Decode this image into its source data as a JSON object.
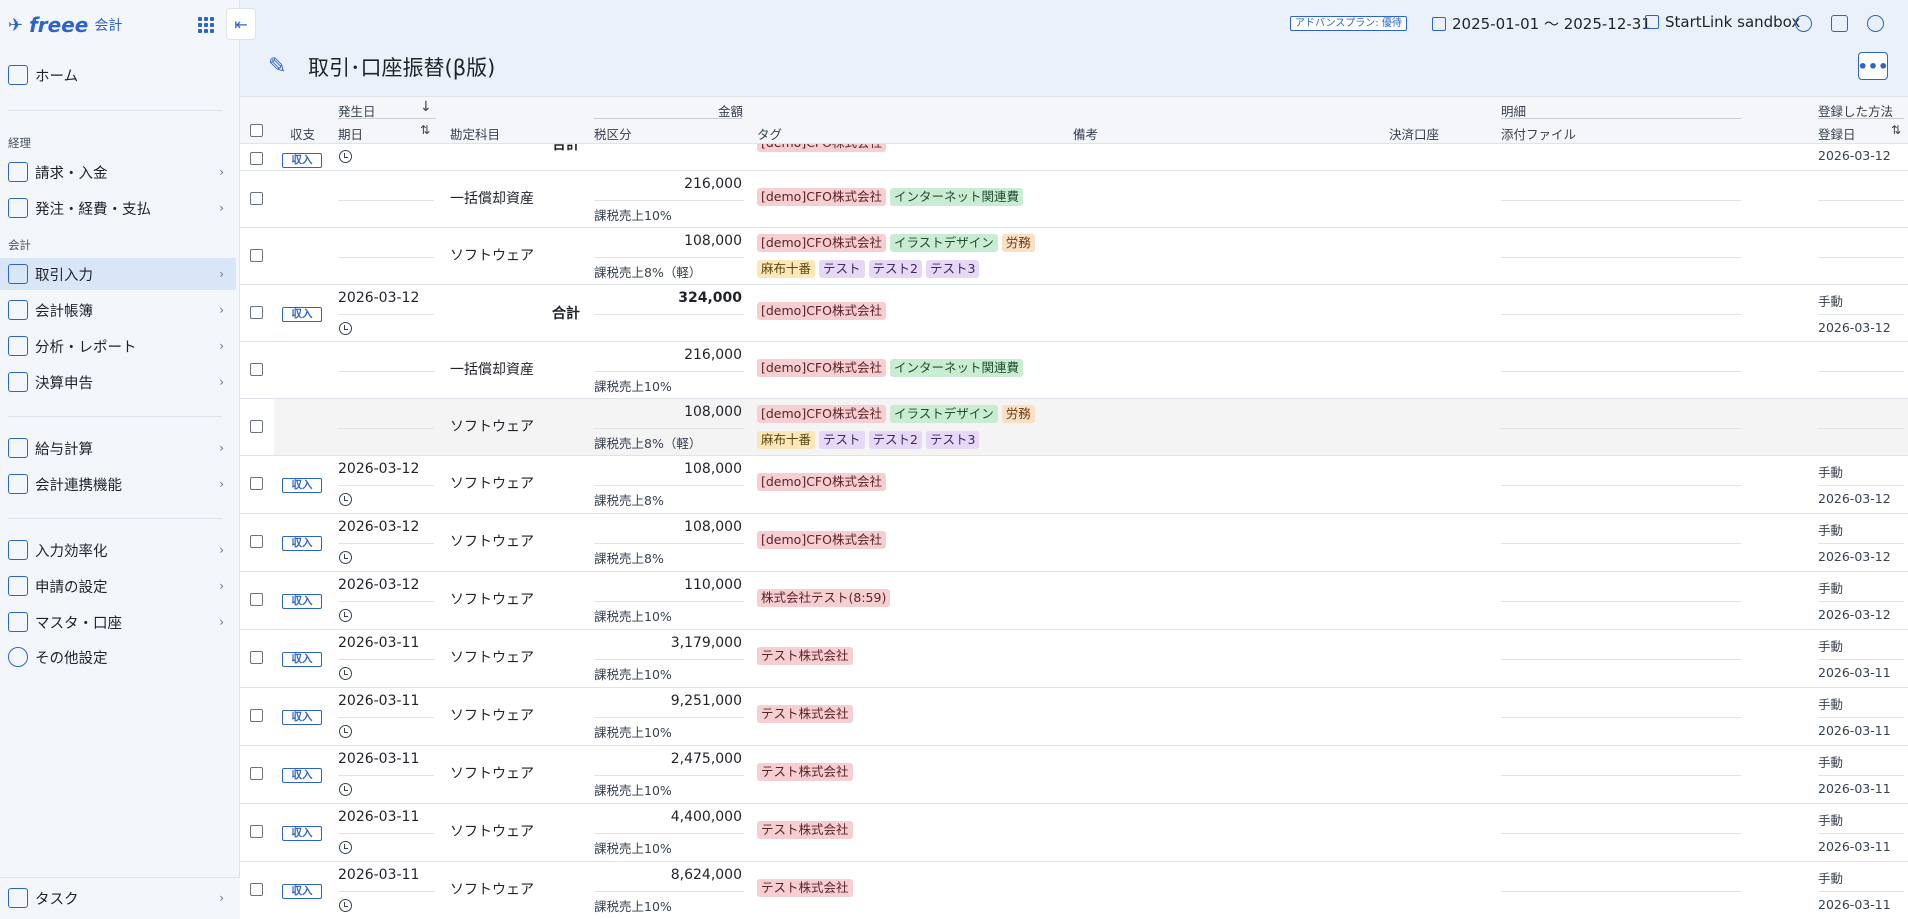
{
  "brand": {
    "logo": "freee",
    "product": "会計"
  },
  "sidebar": {
    "home": "ホーム",
    "group_keiri": "経理",
    "seikyu": "請求・入金",
    "hatchu": "発注・経費・支払",
    "group_kaikei": "会計",
    "torihiki": "取引入力",
    "choubo": "会計帳簿",
    "bunseki": "分析・レポート",
    "kessan": "決算申告",
    "kyuyo": "給与計算",
    "renkei": "会計連携機能",
    "kouritsu": "入力効率化",
    "shinsei": "申請の設定",
    "master": "マスタ・口座",
    "sonota": "その他設定",
    "task": "タスク"
  },
  "topbar": {
    "plan": "アドバンスプラン: 優待",
    "period": "2025-01-01 〜 2025-12-31",
    "company": "StartLink sandbox"
  },
  "page": {
    "title": "取引･口座振替(β版)",
    "more": "•••"
  },
  "table": {
    "headers": {
      "hasseibi": "発生日",
      "kijitsu": "期日",
      "shushi": "収支",
      "kanjou": "勘定科目",
      "kingaku": "金額",
      "zeiku": "税区分",
      "tag": "タグ",
      "bikou": "備考",
      "kessai": "決済口座",
      "meisai": "明細",
      "tenpu": "添付ファイル",
      "houhou": "登録した方法",
      "tourokubi": "登録日"
    },
    "rows": [
      {
        "date": "",
        "income": "収入",
        "account": "合計",
        "amount": "",
        "tax": "",
        "tags": [
          [
            "[demo]CFO株式会社",
            "red"
          ]
        ],
        "method": "",
        "regdate": "2026-03-12"
      },
      {
        "date": "",
        "income": "",
        "account": "一括償却資産",
        "amount": "216,000",
        "tax": "課税売上10%",
        "tags": [
          [
            "[demo]CFO株式会社",
            "red"
          ],
          [
            "インターネット関連費",
            "green"
          ]
        ],
        "method": "",
        "regdate": ""
      },
      {
        "date": "",
        "income": "",
        "account": "ソフトウェア",
        "amount": "108,000",
        "tax": "課税売上8%（軽）",
        "tags": [
          [
            "[demo]CFO株式会社",
            "red"
          ],
          [
            "イラストデザイン",
            "green"
          ],
          [
            "労務",
            "orange"
          ],
          [
            "麻布十番",
            "yellow"
          ],
          [
            "テスト",
            "purple"
          ],
          [
            "テスト2",
            "purple"
          ],
          [
            "テスト3",
            "purple"
          ]
        ],
        "method": "",
        "regdate": ""
      },
      {
        "date": "2026-03-12",
        "income": "収入",
        "account": "合計",
        "amount": "324,000",
        "tax": "",
        "tags": [
          [
            "[demo]CFO株式会社",
            "red"
          ]
        ],
        "method": "手動",
        "regdate": "2026-03-12"
      },
      {
        "date": "",
        "income": "",
        "account": "一括償却資産",
        "amount": "216,000",
        "tax": "課税売上10%",
        "tags": [
          [
            "[demo]CFO株式会社",
            "red"
          ],
          [
            "インターネット関連費",
            "green"
          ]
        ],
        "method": "",
        "regdate": ""
      },
      {
        "date": "",
        "income": "",
        "account": "ソフトウェア",
        "amount": "108,000",
        "tax": "課税売上8%（軽）",
        "tags": [
          [
            "[demo]CFO株式会社",
            "red"
          ],
          [
            "イラストデザイン",
            "green"
          ],
          [
            "労務",
            "orange"
          ],
          [
            "麻布十番",
            "yellow"
          ],
          [
            "テスト",
            "purple"
          ],
          [
            "テスト2",
            "purple"
          ],
          [
            "テスト3",
            "purple"
          ]
        ],
        "method": "",
        "regdate": ""
      },
      {
        "date": "2026-03-12",
        "income": "収入",
        "account": "ソフトウェア",
        "amount": "108,000",
        "tax": "課税売上8%",
        "tags": [
          [
            "[demo]CFO株式会社",
            "red"
          ]
        ],
        "method": "手動",
        "regdate": "2026-03-12"
      },
      {
        "date": "2026-03-12",
        "income": "収入",
        "account": "ソフトウェア",
        "amount": "108,000",
        "tax": "課税売上8%",
        "tags": [
          [
            "[demo]CFO株式会社",
            "red"
          ]
        ],
        "method": "手動",
        "regdate": "2026-03-12"
      },
      {
        "date": "2026-03-12",
        "income": "収入",
        "account": "ソフトウェア",
        "amount": "110,000",
        "tax": "課税売上10%",
        "tags": [
          [
            "株式会社テスト(8:59)",
            "red"
          ]
        ],
        "method": "手動",
        "regdate": "2026-03-12"
      },
      {
        "date": "2026-03-11",
        "income": "収入",
        "account": "ソフトウェア",
        "amount": "3,179,000",
        "tax": "課税売上10%",
        "tags": [
          [
            "テスト株式会社",
            "red"
          ]
        ],
        "method": "手動",
        "regdate": "2026-03-11"
      },
      {
        "date": "2026-03-11",
        "income": "収入",
        "account": "ソフトウェア",
        "amount": "9,251,000",
        "tax": "課税売上10%",
        "tags": [
          [
            "テスト株式会社",
            "red"
          ]
        ],
        "method": "手動",
        "regdate": "2026-03-11"
      },
      {
        "date": "2026-03-11",
        "income": "収入",
        "account": "ソフトウェア",
        "amount": "2,475,000",
        "tax": "課税売上10%",
        "tags": [
          [
            "テスト株式会社",
            "red"
          ]
        ],
        "method": "手動",
        "regdate": "2026-03-11"
      },
      {
        "date": "2026-03-11",
        "income": "収入",
        "account": "ソフトウェア",
        "amount": "4,400,000",
        "tax": "課税売上10%",
        "tags": [
          [
            "テスト株式会社",
            "red"
          ]
        ],
        "method": "手動",
        "regdate": "2026-03-11"
      },
      {
        "date": "2026-03-11",
        "income": "収入",
        "account": "ソフトウェア",
        "amount": "8,624,000",
        "tax": "課税売上10%",
        "tags": [
          [
            "テスト株式会社",
            "red"
          ]
        ],
        "method": "手動",
        "regdate": "2026-03-11"
      }
    ]
  }
}
